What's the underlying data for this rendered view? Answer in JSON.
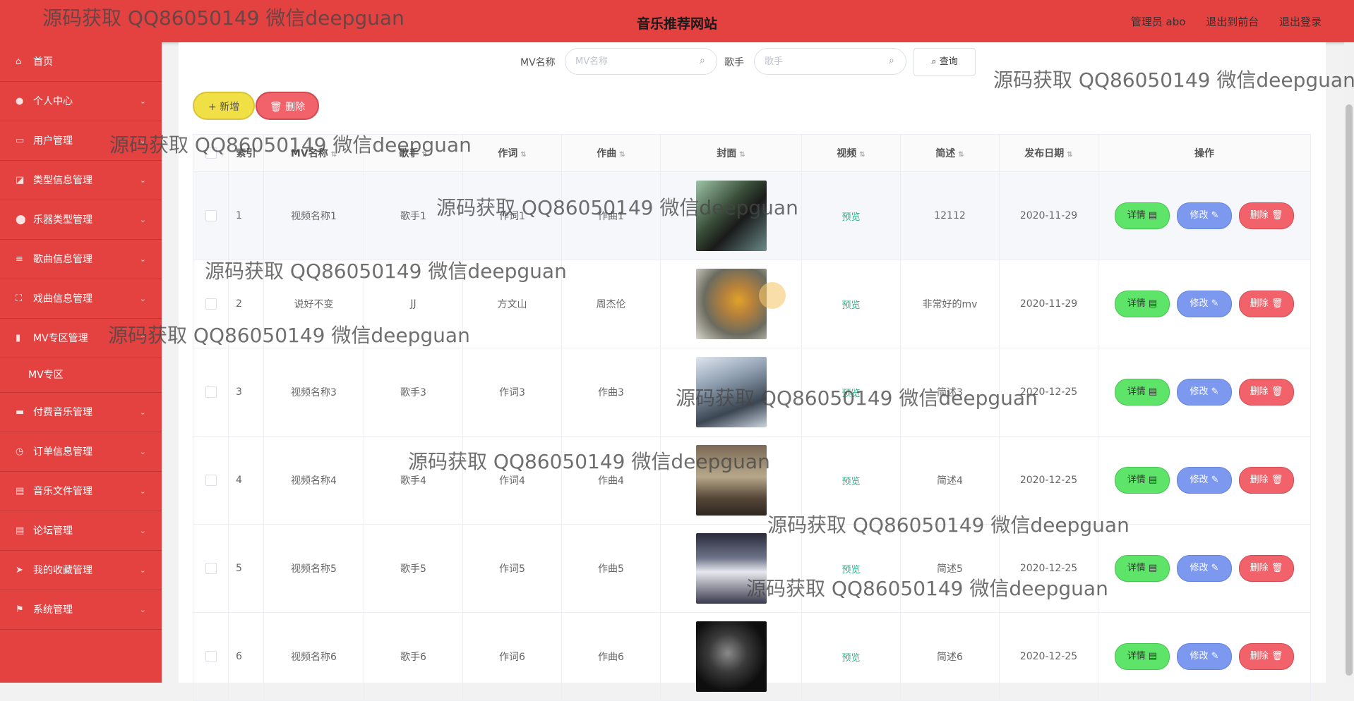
{
  "header": {
    "site_title": "音乐推荐网站",
    "admin_label": "管理员 abo",
    "front_link": "退出到前台",
    "logout_link": "退出登录"
  },
  "sidebar": {
    "items": [
      {
        "label": "首页",
        "icon": "home-icon"
      },
      {
        "label": "个人中心",
        "icon": "user-icon"
      },
      {
        "label": "用户管理",
        "icon": "users-icon"
      },
      {
        "label": "类型信息管理",
        "icon": "tag-icon"
      },
      {
        "label": "乐器类型管理",
        "icon": "pin-icon"
      },
      {
        "label": "歌曲信息管理",
        "icon": "sliders-icon"
      },
      {
        "label": "戏曲信息管理",
        "icon": "frame-icon"
      },
      {
        "label": "MV专区管理",
        "icon": "bar-icon"
      },
      {
        "label": "付费音乐管理",
        "icon": "monitor-icon"
      },
      {
        "label": "订单信息管理",
        "icon": "clock-icon"
      },
      {
        "label": "音乐文件管理",
        "icon": "file-icon"
      },
      {
        "label": "论坛管理",
        "icon": "file-icon"
      },
      {
        "label": "我的收藏管理",
        "icon": "send-icon"
      },
      {
        "label": "系统管理",
        "icon": "flag-icon"
      }
    ],
    "sub_item": "MV专区"
  },
  "search": {
    "mv_label": "MV名称",
    "mv_placeholder": "MV名称",
    "singer_label": "歌手",
    "singer_placeholder": "歌手",
    "query_button": "查询"
  },
  "toolbar": {
    "add_button": "新增",
    "delete_button": "删除"
  },
  "table": {
    "headers": {
      "index": "索引",
      "mv_name": "MV名称",
      "singer": "歌手",
      "lyricist": "作词",
      "composer": "作曲",
      "cover": "封面",
      "video": "视频",
      "description": "简述",
      "release_date": "发布日期",
      "actions": "操作"
    },
    "rows": [
      {
        "index": "1",
        "mv_name": "视频名称1",
        "singer": "歌手1",
        "lyricist": "作词1",
        "composer": "作曲1",
        "video": "预览",
        "description": "12112",
        "release_date": "2020-11-29"
      },
      {
        "index": "2",
        "mv_name": "说好不变",
        "singer": "JJ",
        "lyricist": "方文山",
        "composer": "周杰伦",
        "video": "预览",
        "description": "非常好的mv",
        "release_date": "2020-11-29"
      },
      {
        "index": "3",
        "mv_name": "视频名称3",
        "singer": "歌手3",
        "lyricist": "作词3",
        "composer": "作曲3",
        "video": "预览",
        "description": "简述3",
        "release_date": "2020-12-25"
      },
      {
        "index": "4",
        "mv_name": "视频名称4",
        "singer": "歌手4",
        "lyricist": "作词4",
        "composer": "作曲4",
        "video": "预览",
        "description": "简述4",
        "release_date": "2020-12-25"
      },
      {
        "index": "5",
        "mv_name": "视频名称5",
        "singer": "歌手5",
        "lyricist": "作词5",
        "composer": "作曲5",
        "video": "预览",
        "description": "简述5",
        "release_date": "2020-12-25"
      },
      {
        "index": "6",
        "mv_name": "视频名称6",
        "singer": "歌手6",
        "lyricist": "作词6",
        "composer": "作曲6",
        "video": "预览",
        "description": "简述6",
        "release_date": "2020-12-25"
      }
    ],
    "action_labels": {
      "detail": "详情",
      "edit": "修改",
      "delete": "删除"
    }
  },
  "watermark": "源码获取 QQ86050149 微信deepguan",
  "colors": {
    "brand_red": "#e44141",
    "detail_green": "#5fe46a",
    "edit_blue": "#7d99ef",
    "delete_red": "#f2626a",
    "add_yellow": "#f0df45",
    "preview_green": "#2db38a"
  }
}
